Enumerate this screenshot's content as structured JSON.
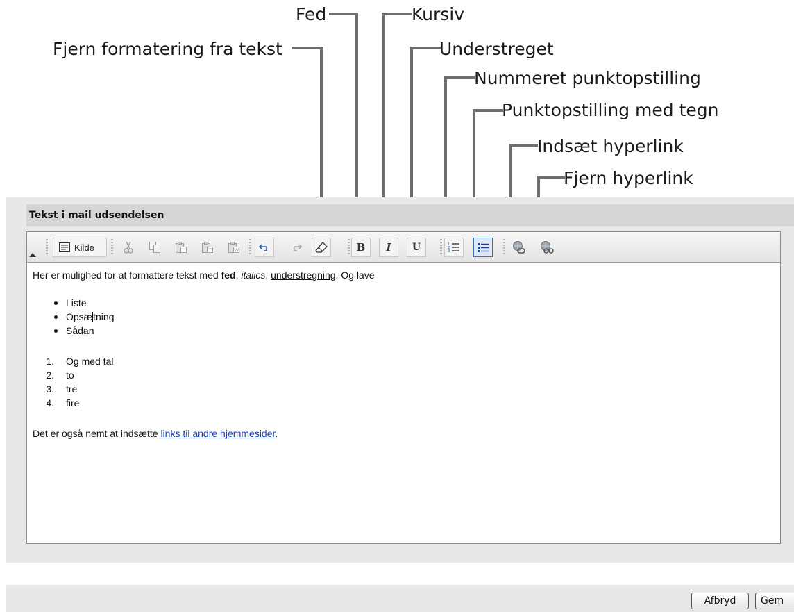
{
  "annotations": {
    "fed": "Fed",
    "kursiv": "Kursiv",
    "fjern_formatering": "Fjern formatering fra tekst",
    "understreget": "Understreget",
    "nummereret": "Nummeret punktopstilling",
    "punkt_tegn": "Punktopstilling med tegn",
    "indsaet_link": "Indsæt hyperlink",
    "fjern_link": "Fjern hyperlink"
  },
  "panel": {
    "title": "Tekst i mail udsendelsen"
  },
  "toolbar": {
    "source_label": "Kilde",
    "bold": "B",
    "italic": "I",
    "underline": "U",
    "icons": [
      "source-icon",
      "cut-icon",
      "copy-icon",
      "paste-icon",
      "paste-text-icon",
      "paste-word-icon",
      "undo-icon",
      "redo-icon",
      "eraser-icon",
      "ordered-list-icon",
      "bullet-list-icon",
      "link-icon",
      "unlink-icon"
    ],
    "active_color": "#3a72c8"
  },
  "content": {
    "line1_a": "Her er mulighed for at formattere tekst med ",
    "bold_word": "fed",
    "sep1": ", ",
    "italic_word": "italics",
    "sep2": ", ",
    "underline_word": "understregning",
    "line1_b": ". Og lave",
    "bullets": [
      "Liste",
      "Opsæ",
      "tning",
      "Sådan"
    ],
    "numbered_markers": [
      "1.",
      "2.",
      "3.",
      "4."
    ],
    "numbered": [
      "Og med tal",
      "to",
      "tre",
      "fire"
    ],
    "last_a": "Det er også nemt at indsætte ",
    "link_text": "links til andre hjemmesider",
    "last_b": "."
  },
  "footer": {
    "cancel_label": "Afbryd",
    "save_label": "Gem"
  }
}
